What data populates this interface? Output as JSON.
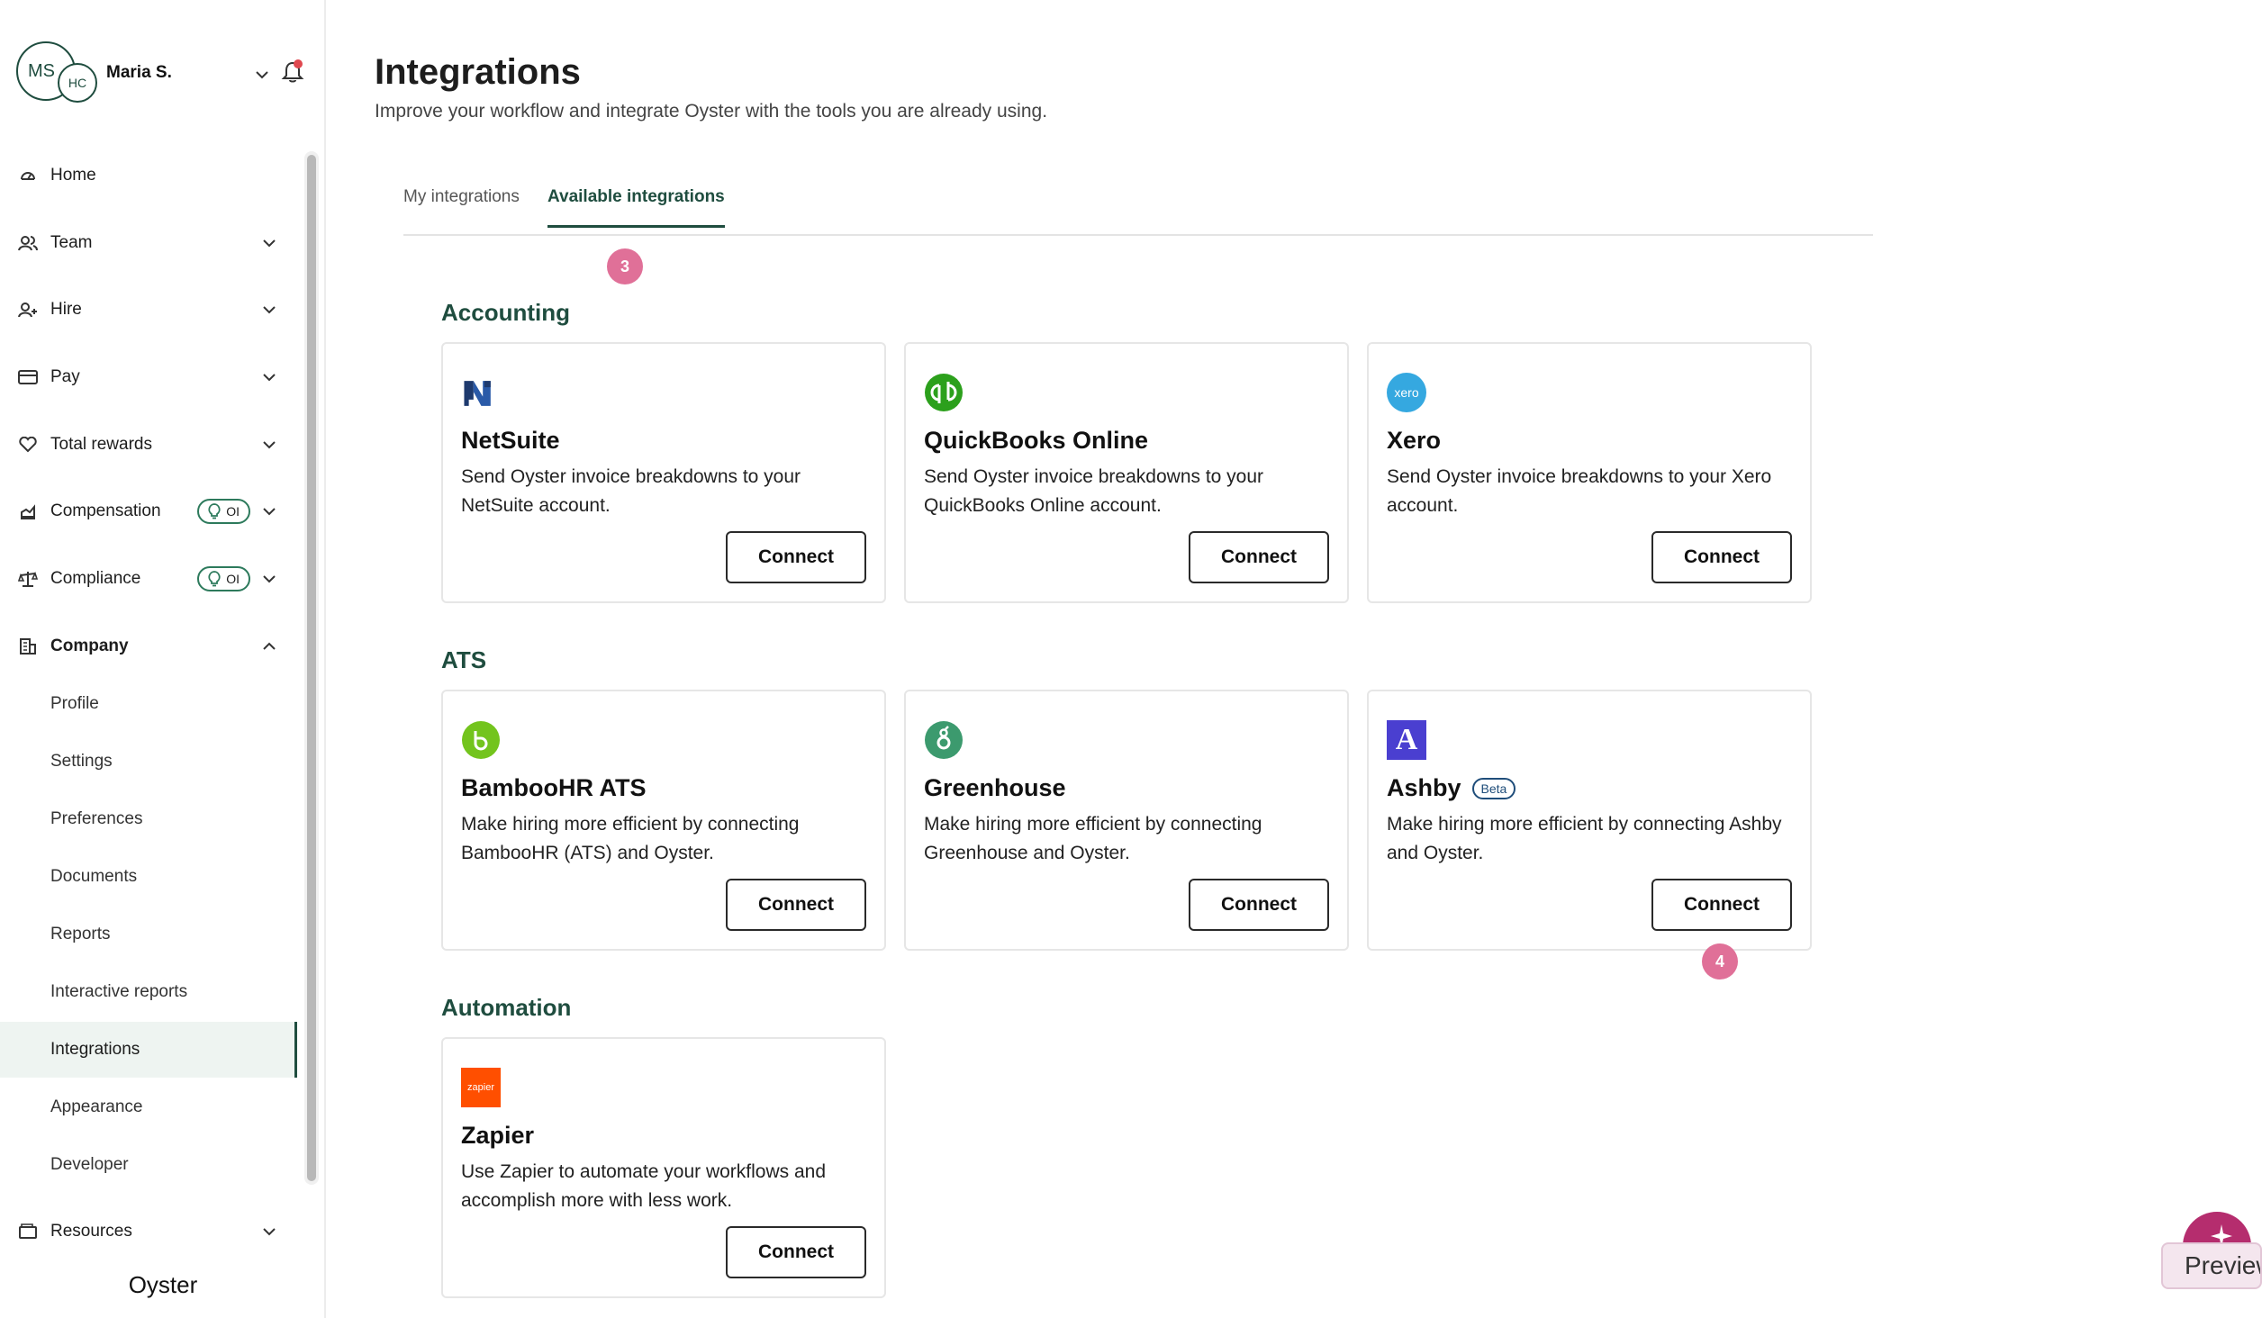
{
  "user": {
    "initials": "MS",
    "secondary_initials": "HC",
    "name": "Maria S."
  },
  "nav": {
    "home": "Home",
    "team": "Team",
    "hire": "Hire",
    "pay": "Pay",
    "total_rewards": "Total rewards",
    "compensation": "Compensation",
    "compliance": "Compliance",
    "ai_badge": "OI",
    "company": "Company",
    "company_items": [
      "Profile",
      "Settings",
      "Preferences",
      "Documents",
      "Reports",
      "Interactive reports",
      "Integrations",
      "Appearance",
      "Developer"
    ],
    "resources": "Resources"
  },
  "brand": "Oyster",
  "page": {
    "title": "Integrations",
    "subtitle": "Improve your workflow and integrate Oyster with the tools you are already using."
  },
  "tabs": {
    "my": "My integrations",
    "available": "Available integrations"
  },
  "steps": {
    "a": "3",
    "b": "4"
  },
  "sections": {
    "accounting": "Accounting",
    "ats": "ATS",
    "automation": "Automation"
  },
  "cards": {
    "netsuite": {
      "name": "NetSuite",
      "desc": "Send Oyster invoice breakdowns to your NetSuite account.",
      "button": "Connect"
    },
    "quickbooks": {
      "name": "QuickBooks Online",
      "desc": "Send Oyster invoice breakdowns to your QuickBooks Online account.",
      "button": "Connect"
    },
    "xero": {
      "name": "Xero",
      "desc": "Send Oyster invoice breakdowns to your Xero account.",
      "button": "Connect",
      "logo_text": "xero"
    },
    "bamboohr": {
      "name": "BambooHR ATS",
      "desc": "Make hiring more efficient by connecting BambooHR (ATS) and Oyster.",
      "button": "Connect"
    },
    "greenhouse": {
      "name": "Greenhouse",
      "desc": "Make hiring more efficient by connecting Greenhouse and Oyster.",
      "button": "Connect"
    },
    "ashby": {
      "name": "Ashby",
      "badge": "Beta",
      "desc": "Make hiring more efficient by connecting Ashby and Oyster.",
      "button": "Connect",
      "logo_text": "A"
    },
    "zapier": {
      "name": "Zapier",
      "desc": "Use Zapier to automate your workflows and accomplish more with less work.",
      "button": "Connect",
      "logo_text": "zapier"
    }
  },
  "preview_label": "Preview",
  "colors": {
    "brand_green": "#1f4d3f",
    "step_pink": "#e07098",
    "active_bg": "#eef4f1"
  }
}
